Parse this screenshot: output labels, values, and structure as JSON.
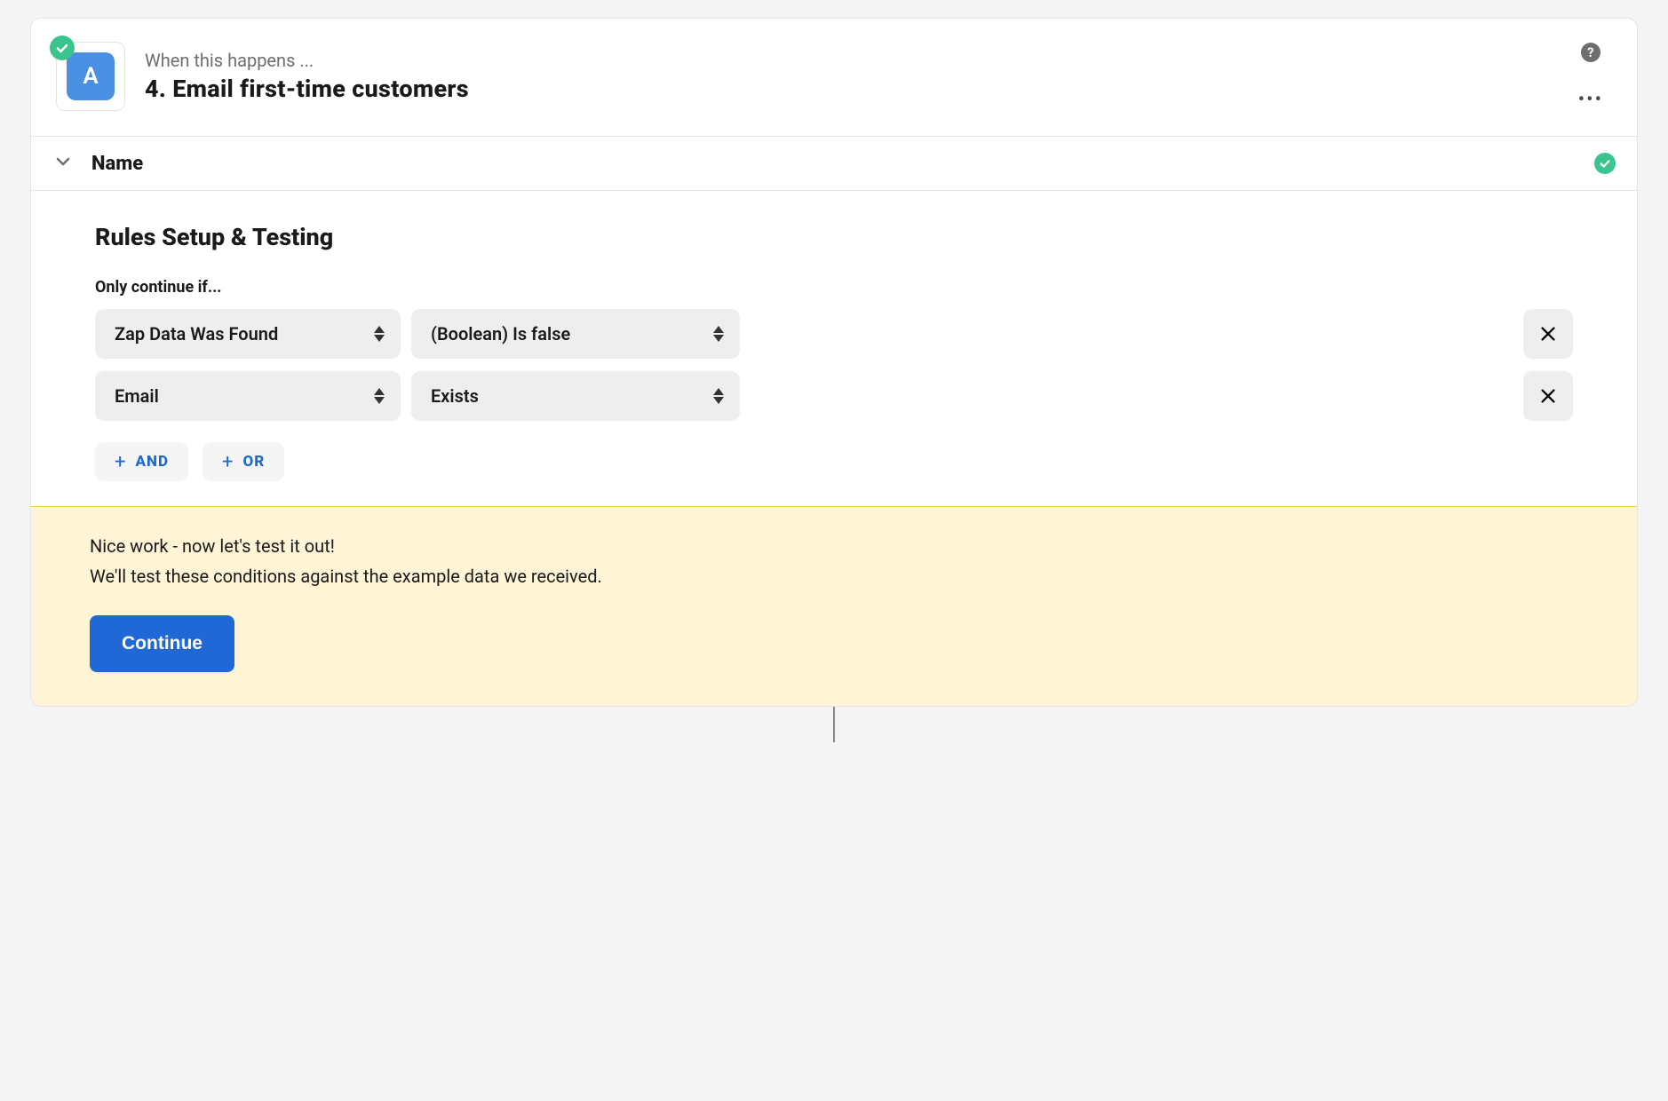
{
  "header": {
    "app_letter": "A",
    "overline": "When this happens ...",
    "title": "4. Email first-time customers"
  },
  "section": {
    "label": "Name"
  },
  "rules": {
    "title": "Rules Setup & Testing",
    "subhead": "Only continue if...",
    "rows": [
      {
        "field": "Zap Data Was Found",
        "condition": "(Boolean) Is false"
      },
      {
        "field": "Email",
        "condition": "Exists"
      }
    ],
    "and_label": "AND",
    "or_label": "OR"
  },
  "test": {
    "line1": "Nice work - now let's test it out!",
    "line2": "We'll test these conditions against the example data we received.",
    "continue_label": "Continue"
  }
}
